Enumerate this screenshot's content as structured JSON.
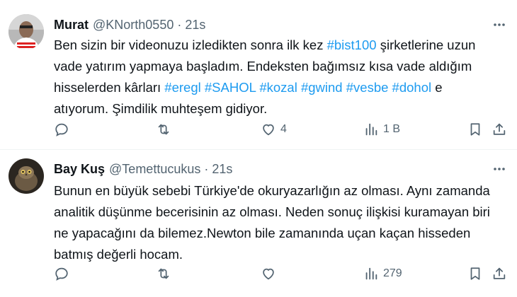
{
  "tweets": [
    {
      "name": "Murat",
      "handle": "@KNorth0550",
      "separator": "·",
      "time": "21s",
      "text_parts": [
        {
          "t": "Ben sizin bir videonuzu izledikten sonra ilk kez ",
          "tag": false
        },
        {
          "t": "#bist100",
          "tag": true
        },
        {
          "t": " şirketlerine uzun vade yatırım yapmaya başladım. Endeksten bağımsız kısa vade aldığım hisselerden kârları ",
          "tag": false
        },
        {
          "t": "#eregl",
          "tag": true
        },
        {
          "t": " ",
          "tag": false
        },
        {
          "t": "#SAHOL",
          "tag": true
        },
        {
          "t": " ",
          "tag": false
        },
        {
          "t": "#kozal",
          "tag": true
        },
        {
          "t": " ",
          "tag": false
        },
        {
          "t": "#gwind",
          "tag": true
        },
        {
          "t": " ",
          "tag": false
        },
        {
          "t": "#vesbe",
          "tag": true
        },
        {
          "t": " ",
          "tag": false
        },
        {
          "t": "#dohol",
          "tag": true
        },
        {
          "t": " e atıyorum. Şimdilik muhteşem gidiyor.",
          "tag": false
        }
      ],
      "likes": "4",
      "views": "1 B",
      "replies": "",
      "retweets": ""
    },
    {
      "name": "Bay Kuş",
      "handle": "@Temettucukus",
      "separator": "·",
      "time": "21s",
      "text_parts": [
        {
          "t": "Bunun en büyük sebebi Türkiye'de okuryazarlığın az olması. Aynı zamanda analitik düşünme becerisinin az olması. Neden sonuç ilişkisi kuramayan biri ne yapacağını da bilemez.Newton bile zamanında uçan kaçan hisseden batmış değerli hocam.",
          "tag": false
        }
      ],
      "likes": "",
      "views": "279",
      "replies": "",
      "retweets": ""
    }
  ],
  "colors": {
    "link": "#1d9bf0",
    "muted": "#536471",
    "text": "#0f1419"
  },
  "icons": [
    "more-icon",
    "reply-icon",
    "retweet-icon",
    "like-icon",
    "views-icon",
    "bookmark-icon",
    "share-icon"
  ]
}
